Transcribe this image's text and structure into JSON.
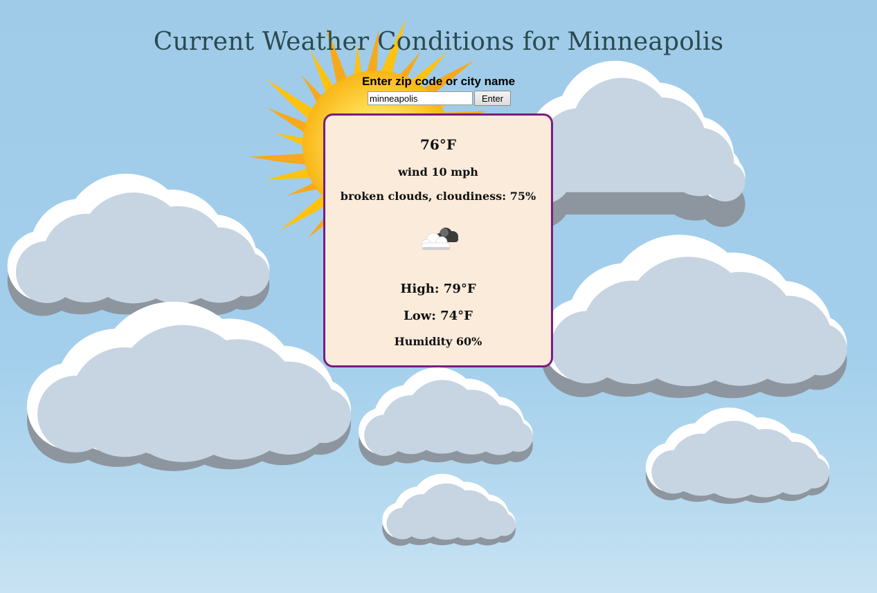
{
  "page": {
    "title": "Current Weather Conditions for Minneapolis"
  },
  "search": {
    "label": "Enter zip code or city name",
    "value": "minneapolis",
    "button_label": "Enter"
  },
  "weather": {
    "temperature": "76°F",
    "wind": "wind 10 mph",
    "description": "broken clouds, cloudiness: 75%",
    "icon": "broken-clouds-icon",
    "high": "High: 79°F",
    "low": "Low: 74°F",
    "humidity": "Humidity 60%"
  },
  "colors": {
    "sky": "#9fcbe9",
    "card_background": "#fbebdb",
    "card_border": "#7a1b7e",
    "title": "#2b4a4f"
  }
}
